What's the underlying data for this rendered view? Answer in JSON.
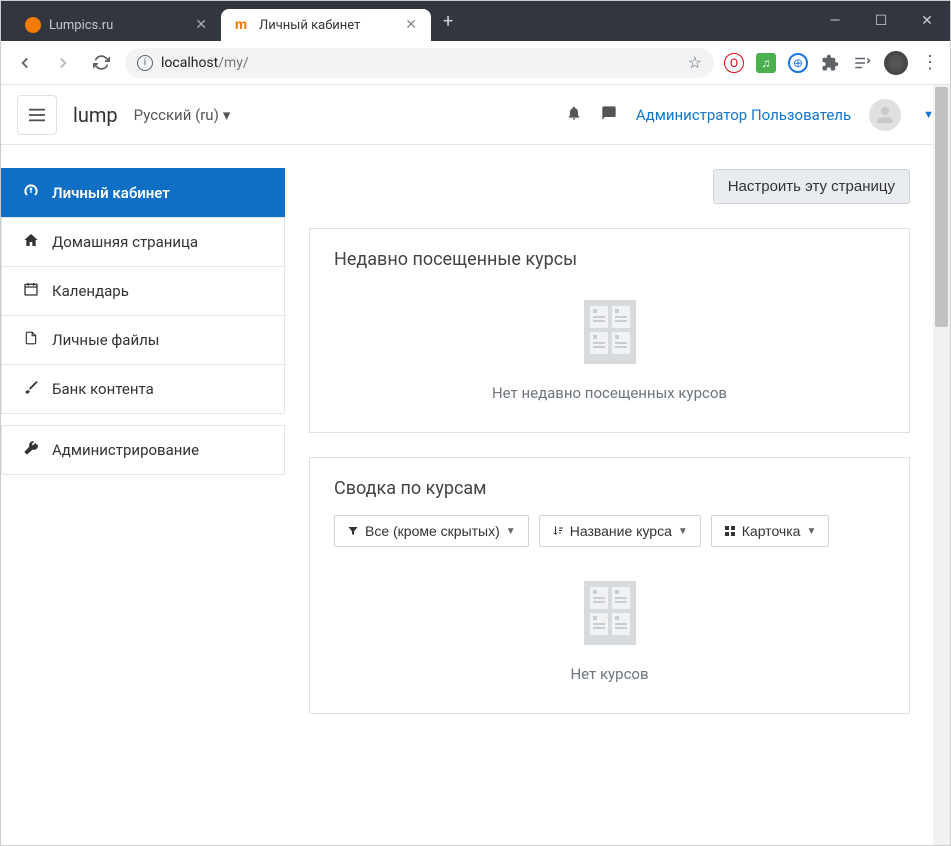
{
  "browser": {
    "tabs": [
      {
        "title": "Lumpics.ru",
        "active": false
      },
      {
        "title": "Личный кабинет",
        "active": true
      }
    ],
    "url_host": "localhost",
    "url_path": "/my/"
  },
  "header": {
    "site_name": "lump",
    "language": "Русский (ru)",
    "user_name": "Администратор Пользователь"
  },
  "sidebar": {
    "items": [
      {
        "label": "Личный кабинет",
        "icon": "dashboard"
      },
      {
        "label": "Домашняя страница",
        "icon": "home"
      },
      {
        "label": "Календарь",
        "icon": "calendar"
      },
      {
        "label": "Личные файлы",
        "icon": "file"
      },
      {
        "label": "Банк контента",
        "icon": "brush"
      },
      {
        "label": "Администрирование",
        "icon": "wrench"
      }
    ]
  },
  "actions": {
    "customize": "Настроить эту страницу"
  },
  "recent": {
    "title": "Недавно посещенные курсы",
    "empty": "Нет недавно посещенных курсов"
  },
  "overview": {
    "title": "Сводка по курсам",
    "filter_all": "Все (кроме скрытых)",
    "sort_name": "Название курса",
    "view_card": "Карточка",
    "empty": "Нет курсов"
  }
}
